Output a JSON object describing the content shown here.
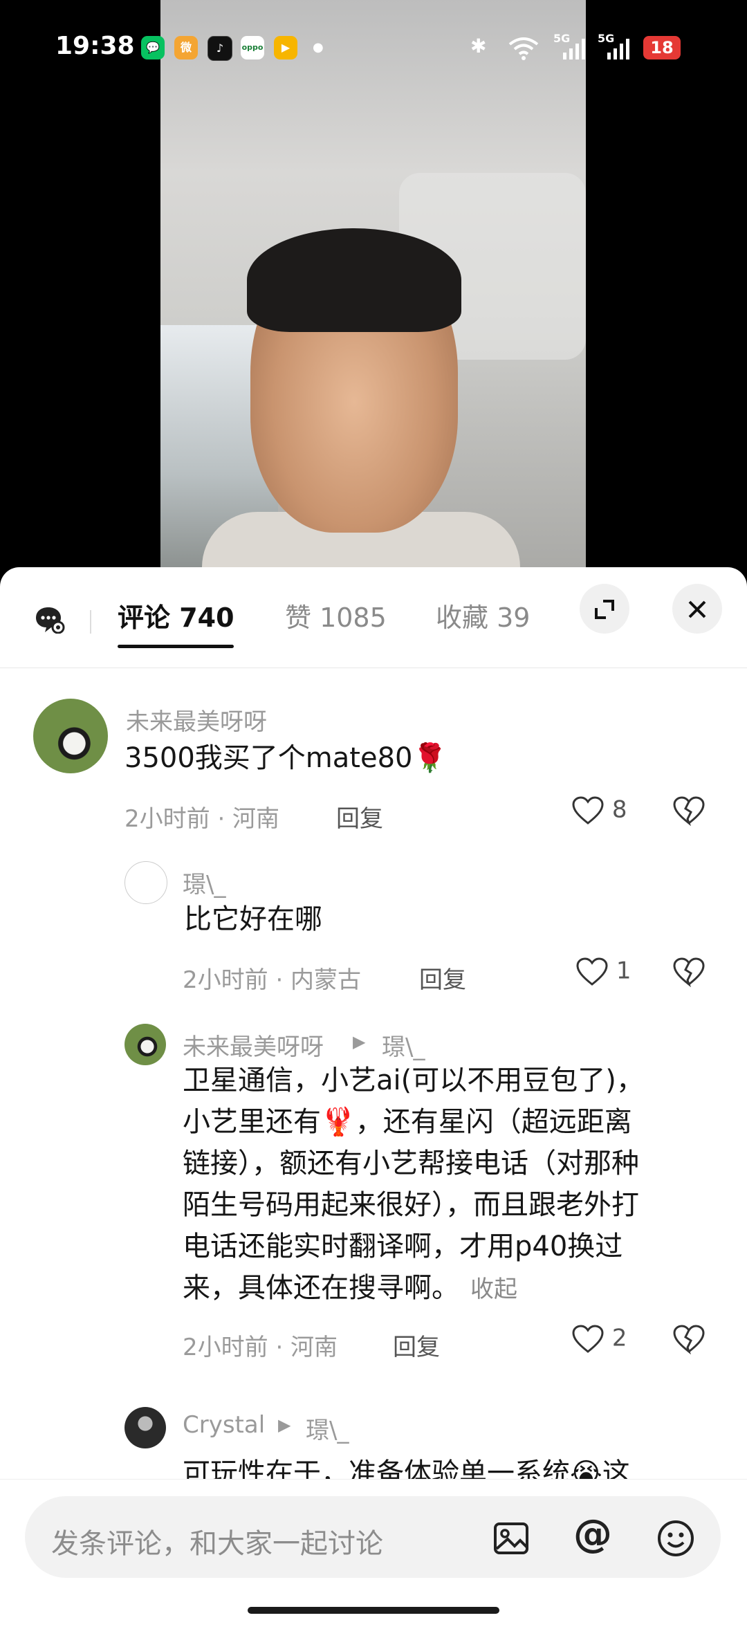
{
  "status_bar": {
    "time": "19:38",
    "apps": [
      "wechat",
      "weibo",
      "tiktok",
      "oppo",
      "video"
    ],
    "signal_label_1": "5G",
    "signal_label_2": "5G",
    "battery": "18"
  },
  "tabs": {
    "comments": "评论 740",
    "likes": "赞 1085",
    "favorites": "收藏 39"
  },
  "comments": [
    {
      "user": "未来最美呀呀",
      "text": "3500我买了个mate80🌹",
      "time_location": "2小时前 · 河南",
      "reply": "回复",
      "likes": "8"
    },
    {
      "user": "璟\\_",
      "text": "比它好在哪",
      "time_location": "2小时前 · 内蒙古",
      "reply": "回复",
      "likes": "1"
    },
    {
      "user": "未来最美呀呀",
      "reply_to": "璟\\_",
      "lines": [
        "卫星通信，小艺ai(可以不用豆包了)，",
        "小艺里还有🦞，还有星闪（超远距离",
        "链接），额还有小艺帮接电话（对那种",
        "陌生号码用起来很好），而且跟老外打",
        "电话还能实时翻译啊，才用p40换过",
        "来，具体还在搜寻啊。"
      ],
      "collapse": "收起",
      "time_location": "2小时前 · 河南",
      "reply": "回复",
      "likes": "2"
    },
    {
      "user": "Crystal",
      "reply_to": "璟\\_",
      "text": "可玩性在于，准备体验单一系统😭这"
    }
  ],
  "input": {
    "placeholder": "发条评论，和大家一起讨论",
    "at": "@"
  }
}
